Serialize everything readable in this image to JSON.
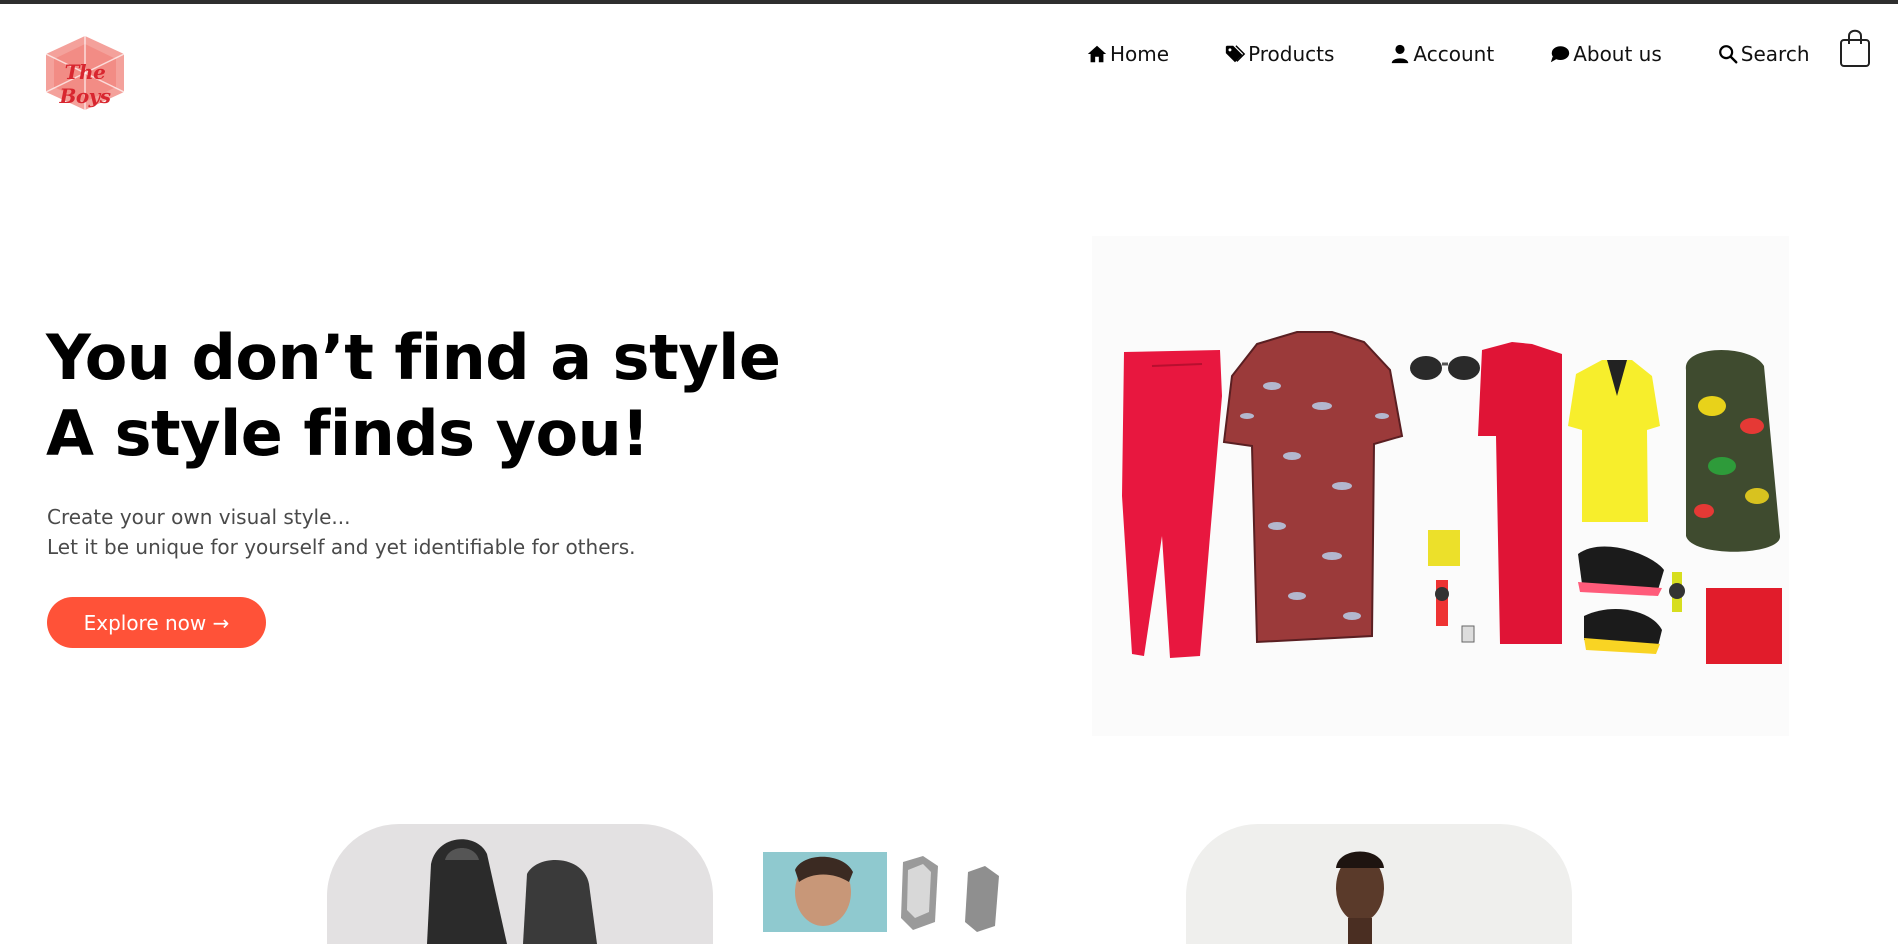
{
  "brand": {
    "name": "The Boys",
    "color": "#d8262f",
    "badge_color": "#f29089"
  },
  "nav": {
    "items": [
      {
        "label": "Home",
        "icon": "home-icon"
      },
      {
        "label": "Products",
        "icon": "tag-icon"
      },
      {
        "label": "Account",
        "icon": "user-icon"
      },
      {
        "label": "About us",
        "icon": "chat-icon"
      },
      {
        "label": "Search",
        "icon": "search-icon"
      }
    ],
    "cart_icon": "shopping-bag-icon"
  },
  "hero": {
    "title_line1": "You don’t find a style",
    "title_line2": "A style finds you!",
    "subtitle_line1": "Create your own visual style...",
    "subtitle_line2": "Let it be unique for yourself and yet identifiable for others.",
    "cta_label": "Explore now →",
    "cta_color": "#ff5238",
    "image": "clothing-flatlay"
  },
  "showcase": {
    "cards": [
      "shoes-photo",
      "accessories-photo",
      "model-photo"
    ]
  }
}
